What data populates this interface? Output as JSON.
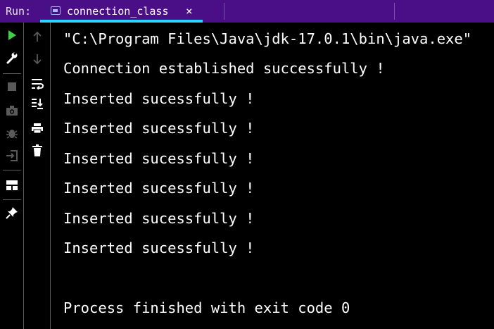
{
  "run_panel": {
    "label": "Run:",
    "tab": {
      "title": "connection_class",
      "close_glyph": "×",
      "icon": "application-window-icon"
    }
  },
  "left_toolbar": {
    "tools": [
      {
        "name": "rerun-icon",
        "color": "#3fcf4a"
      },
      {
        "name": "wrench-icon",
        "color": "#ffffff"
      },
      {
        "name": "stop-icon",
        "color": "#5a5a5a"
      },
      {
        "name": "camera-icon",
        "color": "#5a5a5a"
      },
      {
        "name": "debug-bug-icon",
        "color": "#5a5a5a"
      },
      {
        "name": "exit-icon",
        "color": "#5a5a5a"
      },
      {
        "name": "layout-icon",
        "color": "#ffffff"
      },
      {
        "name": "pin-icon",
        "color": "#ffffff"
      }
    ]
  },
  "console_toolbar": {
    "tools": [
      {
        "name": "arrow-up-icon",
        "color": "#5a5a5a"
      },
      {
        "name": "arrow-down-icon",
        "color": "#5a5a5a"
      },
      {
        "name": "soft-wrap-icon",
        "color": "#ffffff"
      },
      {
        "name": "scroll-to-end-icon",
        "color": "#ffffff"
      },
      {
        "name": "print-icon",
        "color": "#ffffff"
      },
      {
        "name": "trash-icon",
        "color": "#ffffff"
      }
    ]
  },
  "console": {
    "lines": [
      "\"C:\\Program Files\\Java\\jdk-17.0.1\\bin\\java.exe\"",
      "Connection established successfully !",
      "Inserted sucessfully !",
      "Inserted sucessfully !",
      "Inserted sucessfully !",
      "Inserted sucessfully !",
      "Inserted sucessfully !",
      "Inserted sucessfully !",
      "",
      "Process finished with exit code 0"
    ]
  },
  "colors": {
    "header_bg": "#4a0f86",
    "tab_underline": "#2ed2ff",
    "console_bg": "#000000",
    "console_text": "#ffffff",
    "run_green": "#3fcf4a"
  }
}
